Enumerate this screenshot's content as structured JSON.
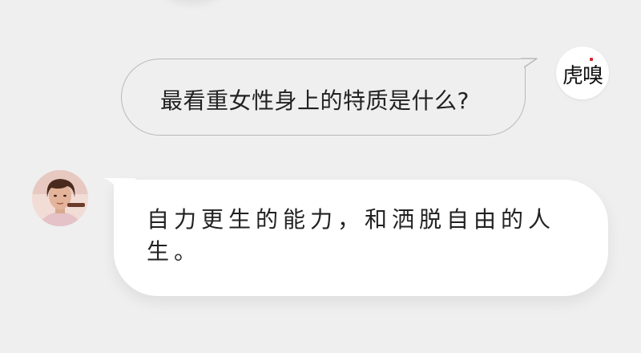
{
  "conversation": {
    "question": "最看重女性身上的特质是什么?",
    "answer": "自力更生的能力，和洒脱自由的人生。"
  },
  "avatars": {
    "host_logo": "虎嗅",
    "host_logo_icon": "huxiu-logo-icon",
    "guest_icon": "person-avatar-icon"
  },
  "colors": {
    "background": "#efefef",
    "question_border": "#b9b9b9",
    "answer_bubble": "#ffffff",
    "text": "#222222",
    "logo_accent": "#d6262d"
  }
}
